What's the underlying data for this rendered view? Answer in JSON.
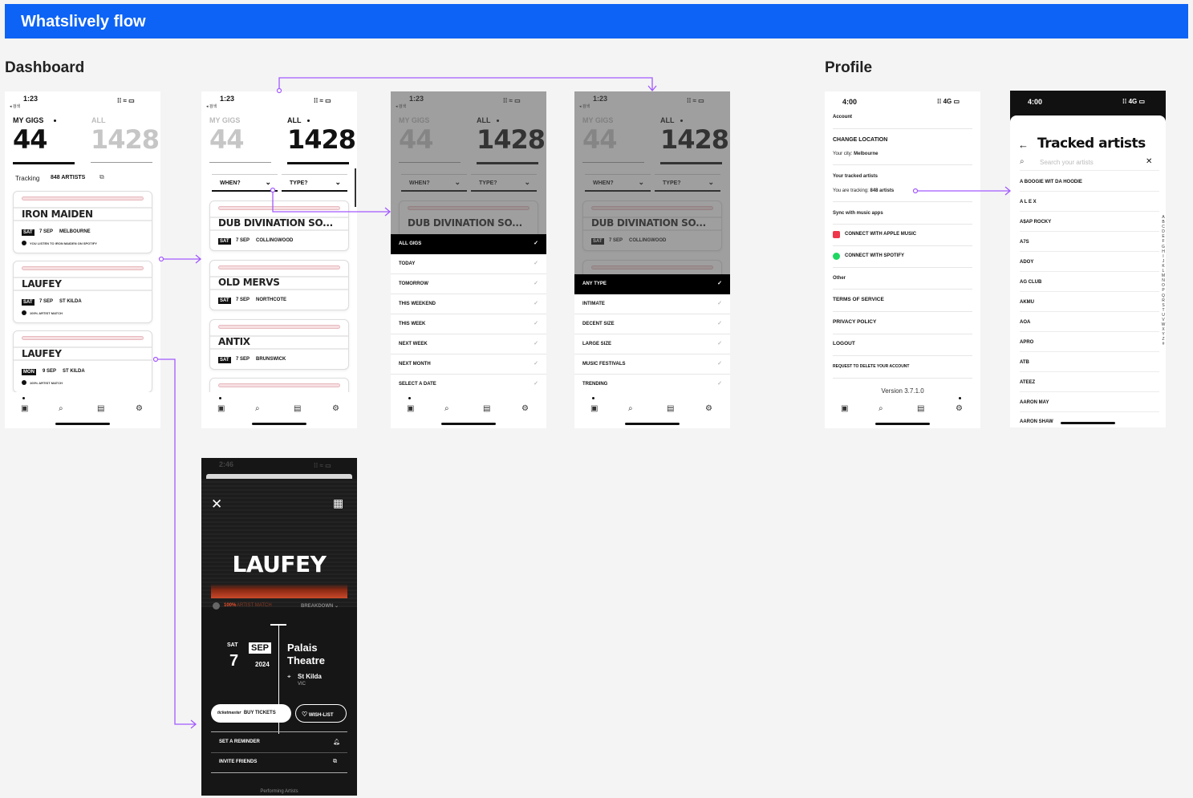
{
  "banner": {
    "title": "Whatslively flow"
  },
  "sections": {
    "dashboard": "Dashboard",
    "profile": "Profile"
  },
  "status": {
    "time_a": "1:23",
    "back_a": "◂ 검색",
    "time_b": "4:00",
    "net_b": "4G"
  },
  "counts": {
    "my_gigs_label": "MY GIGS",
    "all_label": "ALL",
    "my_gigs": "44",
    "all": "1428"
  },
  "tracking": {
    "label": "Tracking",
    "count": "848 ARTISTS"
  },
  "filters": {
    "when": "WHEN?",
    "type": "TYPE?"
  },
  "screen1_cards": [
    {
      "title": "IRON MAIDEN",
      "day": "SAT",
      "date": "7 SEP",
      "venue": "MELBOURNE",
      "note": "YOU LISTEN TO IRON MAIDEN ON SPOTIFY"
    },
    {
      "title": "LAUFEY",
      "day": "SAT",
      "date": "7 SEP",
      "venue": "ST KILDA",
      "note": "100% ARTIST MATCH"
    },
    {
      "title": "LAUFEY",
      "day": "MON",
      "date": "9 SEP",
      "venue": "ST KILDA",
      "note": "100% ARTIST MATCH"
    }
  ],
  "screen2_cards": [
    {
      "title": "DUB DIVINATION SO...",
      "day": "SAT",
      "date": "7 SEP",
      "venue": "COLLINGWOOD"
    },
    {
      "title": "OLD MERVS",
      "day": "SAT",
      "date": "7 SEP",
      "venue": "NORTHCOTE"
    },
    {
      "title": "ANTIX",
      "day": "SAT",
      "date": "7 SEP",
      "venue": "BRUNSWICK"
    }
  ],
  "when_menu": [
    "ALL GIGS",
    "TODAY",
    "TOMORROW",
    "THIS WEEKEND",
    "THIS WEEK",
    "NEXT WEEK",
    "NEXT MONTH",
    "SELECT A DATE"
  ],
  "type_menu": [
    "ANY TYPE",
    "INTIMATE",
    "DECENT SIZE",
    "LARGE SIZE",
    "MUSIC FESTIVALS",
    "TRENDING"
  ],
  "profile": {
    "account": "Account",
    "change_location": "CHANGE LOCATION",
    "city_label": "Your city:",
    "city": "Melbourne",
    "tracked_heading": "Your tracked artists",
    "tracking_label": "You are tracking:",
    "tracking_count": "848 artists",
    "sync": "Sync with music apps",
    "apple": "CONNECT WITH APPLE MUSIC",
    "spotify": "CONNECT WITH SPOTIFY",
    "other": "Other",
    "terms": "TERMS OF SERVICE",
    "privacy": "PRIVACY POLICY",
    "logout": "LOGOUT",
    "delete": "REQUEST TO DELETE YOUR ACCOUNT",
    "version": "Version 3.7.1.0"
  },
  "tracked": {
    "title": "Tracked artists",
    "search_placeholder": "Search your artists",
    "artists": [
      "A BOOGIE WIT DA HOODIE",
      "A L E X",
      "A$AP ROCKY",
      "A7S",
      "ADOY",
      "AG CLUB",
      "AKMU",
      "AOA",
      "APRO",
      "ATB",
      "ATEEZ",
      "AARON MAY",
      "AARON SHAW"
    ],
    "alphabet": [
      "A",
      "B",
      "C",
      "D",
      "E",
      "F",
      "G",
      "H",
      "I",
      "J",
      "K",
      "L",
      "M",
      "N",
      "O",
      "P",
      "Q",
      "R",
      "S",
      "T",
      "U",
      "V",
      "W",
      "X",
      "Y",
      "Z",
      "#"
    ]
  },
  "detail": {
    "time": "2:46",
    "artist": "LAUFEY",
    "match_pct": "100%",
    "match_label": "ARTIST MATCH",
    "breakdown": "BREAKDOWN",
    "day": "SAT",
    "month": "SEP",
    "date": "7",
    "year": "2024",
    "venue_line1": "Palais",
    "venue_line2": "Theatre",
    "suburb": "St Kilda",
    "state": "VIC",
    "ticketmaster": "ticketmaster",
    "buy": "BUY TICKETS",
    "wishlist": "WISH-LIST",
    "reminder": "SET A REMINDER",
    "invite": "INVITE FRIENDS",
    "performing": "Performing Artists"
  },
  "colors": {
    "banner": "#0d63f5",
    "connector": "#a259ff",
    "dark": "#111111",
    "match": "#e8512b"
  }
}
